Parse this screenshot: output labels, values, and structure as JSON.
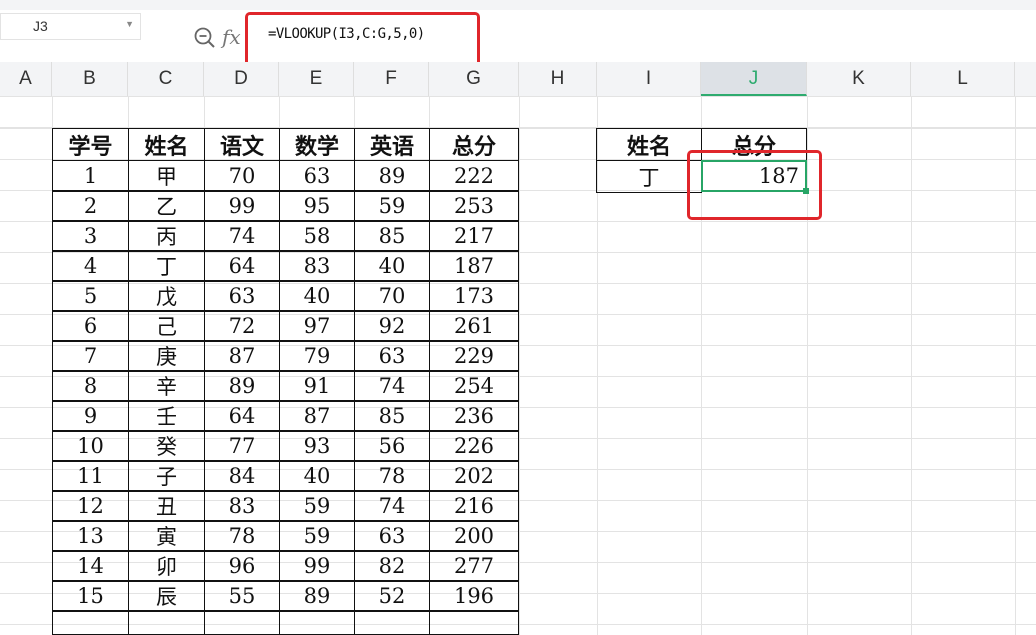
{
  "name_box": {
    "value": "J3"
  },
  "formula_bar": {
    "fx_label": "fx",
    "formula": "=VLOOKUP(I3,C:G,5,0)"
  },
  "columns": [
    "A",
    "B",
    "C",
    "D",
    "E",
    "F",
    "G",
    "H",
    "I",
    "J",
    "K",
    "L"
  ],
  "selected_column": "J",
  "main_table": {
    "headers": [
      "学号",
      "姓名",
      "语文",
      "数学",
      "英语",
      "总分"
    ],
    "rows": [
      [
        "1",
        "甲",
        "70",
        "63",
        "89",
        "222"
      ],
      [
        "2",
        "乙",
        "99",
        "95",
        "59",
        "253"
      ],
      [
        "3",
        "丙",
        "74",
        "58",
        "85",
        "217"
      ],
      [
        "4",
        "丁",
        "64",
        "83",
        "40",
        "187"
      ],
      [
        "5",
        "戊",
        "63",
        "40",
        "70",
        "173"
      ],
      [
        "6",
        "己",
        "72",
        "97",
        "92",
        "261"
      ],
      [
        "7",
        "庚",
        "87",
        "79",
        "63",
        "229"
      ],
      [
        "8",
        "辛",
        "89",
        "91",
        "74",
        "254"
      ],
      [
        "9",
        "壬",
        "64",
        "87",
        "85",
        "236"
      ],
      [
        "10",
        "癸",
        "77",
        "93",
        "56",
        "226"
      ],
      [
        "11",
        "子",
        "84",
        "40",
        "78",
        "202"
      ],
      [
        "12",
        "丑",
        "83",
        "59",
        "74",
        "216"
      ],
      [
        "13",
        "寅",
        "78",
        "59",
        "63",
        "200"
      ],
      [
        "14",
        "卯",
        "96",
        "99",
        "82",
        "277"
      ],
      [
        "15",
        "辰",
        "55",
        "89",
        "52",
        "196"
      ]
    ]
  },
  "lookup_table": {
    "headers": [
      "姓名",
      "总分"
    ],
    "name": "丁",
    "result": "187"
  },
  "colors": {
    "highlight_red": "#e0262b",
    "selection_green": "#27a566"
  }
}
